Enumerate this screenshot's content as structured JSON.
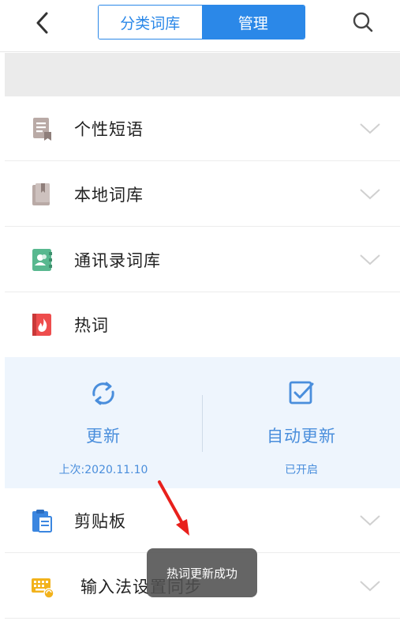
{
  "header": {
    "tabs": [
      {
        "label": "分类词库",
        "active": false
      },
      {
        "label": "管理",
        "active": true
      }
    ],
    "accent_color": "#2b88e8"
  },
  "rows": [
    {
      "label": "个性短语",
      "icon": "phrase-doc-icon"
    },
    {
      "label": "本地词库",
      "icon": "book-icon"
    },
    {
      "label": "通讯录词库",
      "icon": "contacts-book-icon"
    },
    {
      "label": "热词",
      "icon": "hot-flame-icon"
    },
    {
      "label": "剪贴板",
      "icon": "clipboard-icon"
    },
    {
      "label": "输入法设置同步",
      "icon": "keyboard-sync-icon"
    }
  ],
  "hot_panel": {
    "update": {
      "title": "更新",
      "subtitle": "上次:2020.11.10",
      "icon": "refresh-icon"
    },
    "auto_update": {
      "title": "自动更新",
      "subtitle": "已开启",
      "icon": "checkbox-icon"
    }
  },
  "toast": {
    "text": "热词更新成功"
  }
}
